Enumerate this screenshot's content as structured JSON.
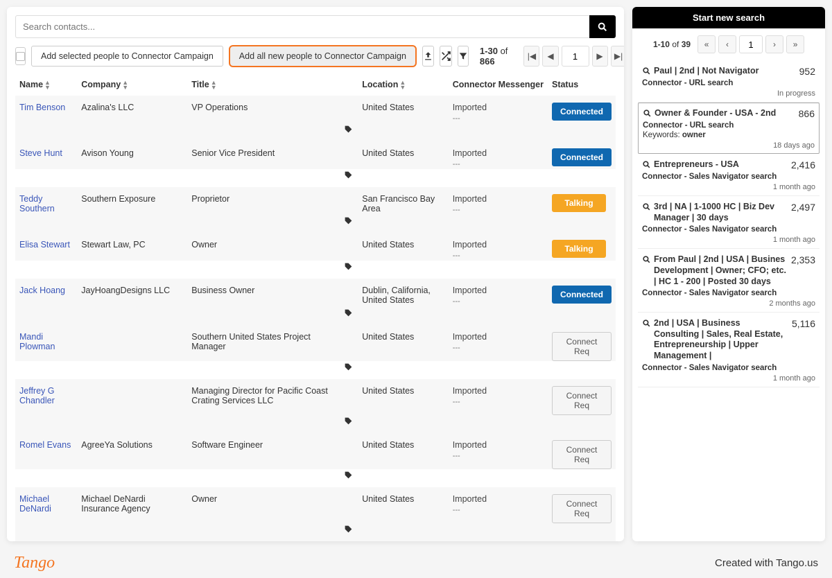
{
  "search": {
    "placeholder": "Search contacts..."
  },
  "toolbar": {
    "add_selected": "Add selected people to Connector Campaign",
    "add_all_new": "Add all new people to Connector Campaign"
  },
  "pagination": {
    "range_label": "1-30",
    "of": "of",
    "total": "866",
    "page": "1"
  },
  "columns": {
    "name": "Name",
    "company": "Company",
    "title": "Title",
    "location": "Location",
    "messenger": "Connector Messenger",
    "status": "Status"
  },
  "rows": [
    {
      "name": "Tim Benson",
      "company": "Azalina's LLC",
      "title": "VP Operations",
      "location": "United States",
      "messenger": "Imported",
      "status_type": "connected",
      "status_label": "Connected"
    },
    {
      "name": "Steve Hunt",
      "company": "Avison Young",
      "title": "Senior Vice President",
      "location": "United States",
      "messenger": "Imported",
      "status_type": "connected",
      "status_label": "Connected"
    },
    {
      "name": "Teddy Southern",
      "company": "Southern Exposure",
      "title": "Proprietor",
      "location": "San Francisco Bay Area",
      "messenger": "Imported",
      "status_type": "talking",
      "status_label": "Talking"
    },
    {
      "name": "Elisa Stewart",
      "company": "Stewart Law, PC",
      "title": "Owner",
      "location": "United States",
      "messenger": "Imported",
      "status_type": "talking",
      "status_label": "Talking"
    },
    {
      "name": "Jack Hoang",
      "company": "JayHoangDesigns LLC",
      "title": "Business Owner",
      "location": "Dublin, California, United States",
      "messenger": "Imported",
      "status_type": "connected",
      "status_label": "Connected"
    },
    {
      "name": "Mandi Plowman",
      "company": "",
      "title": "Southern United States Project Manager",
      "location": "United States",
      "messenger": "Imported",
      "status_type": "connectreq",
      "status_label": "Connect Req"
    },
    {
      "name": "Jeffrey G Chandler",
      "company": "",
      "title": "Managing Director for Pacific Coast Crating Services LLC",
      "location": "United States",
      "messenger": "Imported",
      "status_type": "connectreq",
      "status_label": "Connect Req"
    },
    {
      "name": "Romel Evans",
      "company": "AgreeYa Solutions",
      "title": "Software Engineer",
      "location": "United States",
      "messenger": "Imported",
      "status_type": "connectreq",
      "status_label": "Connect Req"
    },
    {
      "name": "Michael DeNardi",
      "company": "Michael DeNardi Insurance Agency",
      "title": "Owner",
      "location": "United States",
      "messenger": "Imported",
      "status_type": "connectreq",
      "status_label": "Connect Req"
    }
  ],
  "side": {
    "header": "Start new search",
    "pagination": {
      "range_label": "1-10",
      "of": "of",
      "total": "39",
      "page": "1"
    },
    "items": [
      {
        "title": "Paul | 2nd | Not Navigator",
        "count": "952",
        "sub": "Connector - URL search",
        "kw": "",
        "time": "In progress",
        "active": false
      },
      {
        "title": "Owner & Founder - USA - 2nd",
        "count": "866",
        "sub": "Connector - URL search",
        "kw": "Keywords: owner",
        "time": "18 days ago",
        "active": true
      },
      {
        "title": "Entrepreneurs - USA",
        "count": "2,416",
        "sub": "Connector - Sales Navigator search",
        "kw": "",
        "time": "1 month ago",
        "active": false
      },
      {
        "title": "3rd | NA | 1-1000 HC | Biz Dev Manager | 30 days",
        "count": "2,497",
        "sub": "Connector - Sales Navigator search",
        "kw": "",
        "time": "1 month ago",
        "active": false
      },
      {
        "title": "From Paul | 2nd | USA | Busines Development | Owner; CFO; etc. | HC 1 - 200 | Posted 30 days",
        "count": "2,353",
        "sub": "Connector - Sales Navigator search",
        "kw": "",
        "time": "2 months ago",
        "active": false
      },
      {
        "title": "2nd | USA | Business Consulting | Sales, Real Estate, Entrepreneurship | Upper Management |",
        "count": "5,116",
        "sub": "Connector - Sales Navigator search",
        "kw": "",
        "time": "1 month ago",
        "active": false
      }
    ]
  },
  "footer": {
    "logo": "Tango",
    "credit": "Created with Tango.us"
  }
}
